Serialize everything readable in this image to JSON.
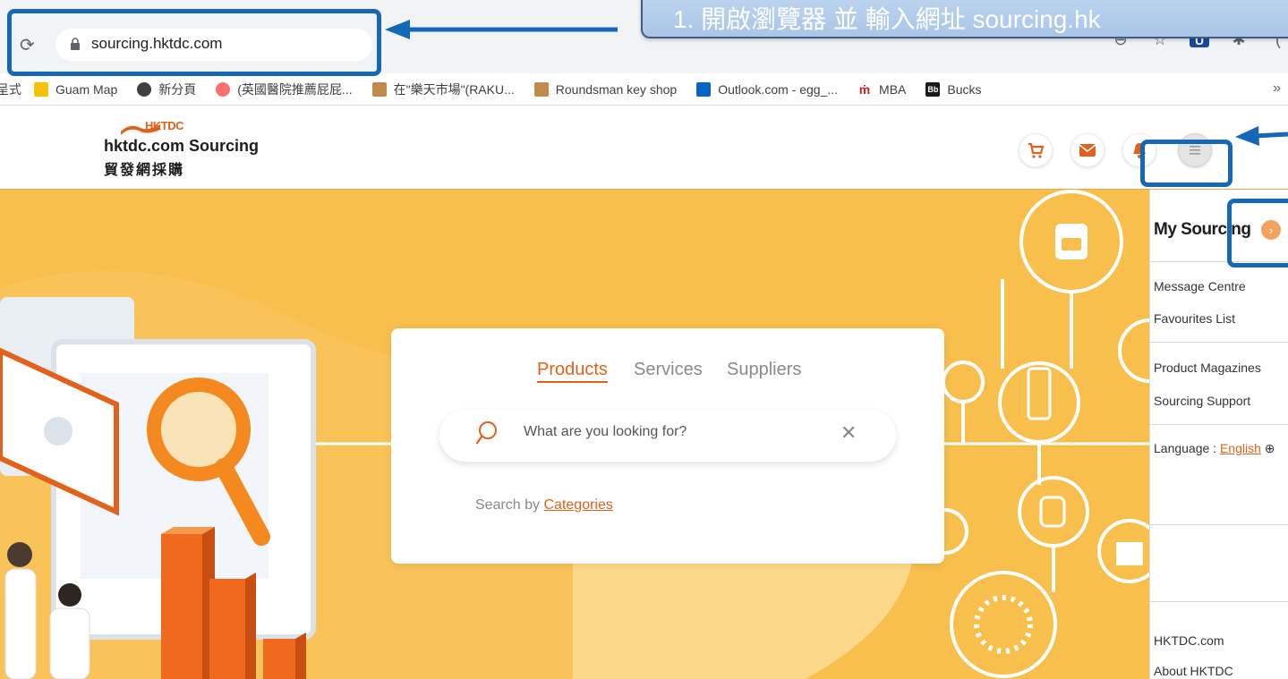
{
  "browser": {
    "url": "sourcing.hktdc.com",
    "reload_icon": "reload-icon",
    "bookmarks_overflow": "»",
    "bookmarks": [
      {
        "label": "呈式",
        "icon_color": ""
      },
      {
        "label": "Guam Map",
        "icon_color": "#f4c20d"
      },
      {
        "label": "新分頁",
        "icon_color": "#3c4043"
      },
      {
        "label": "(英國醫院推薦屁屁...",
        "icon_color": "#ff6f6f"
      },
      {
        "label": "在\"樂天市場\"(RAKU...",
        "icon_color": "#c08a4a"
      },
      {
        "label": "Roundsman key shop",
        "icon_color": "#c08a4a"
      },
      {
        "label": "Outlook.com - egg_...",
        "icon_color": "#0a64c2"
      },
      {
        "label": "MBA",
        "icon_color": "#d71920"
      },
      {
        "label": "Bucks",
        "icon_color": "#1a1a1a"
      }
    ],
    "bucks_icon_text": "Bb"
  },
  "site": {
    "logo_text": "HKTDC",
    "brand_en": "hktdc.com Sourcing",
    "brand_zh": "貿發網採購",
    "accent": "#e2621b"
  },
  "search": {
    "tabs": [
      "Products",
      "Services",
      "Suppliers"
    ],
    "active_tab": "Products",
    "placeholder": "What are you looking for?",
    "clear_symbol": "✕",
    "search_by_prefix": "Search by",
    "categories_link": "Categories"
  },
  "side_panel": {
    "title": "My Sourcing",
    "arrow": "›",
    "links": [
      "Message Centre",
      "Favourites List",
      "Product Magazines",
      "Sourcing Support"
    ],
    "language_label": "Language :",
    "language_value": "English",
    "language_icon": "globe-icon",
    "footer_links": [
      "HKTDC.com",
      "About HKTDC"
    ]
  },
  "callout": {
    "text": "1. 開啟瀏覽器 並 輸入網址 sourcing.hk"
  },
  "colors": {
    "hero_bg": "#f9bf4c",
    "highlight": "#1567b7"
  }
}
